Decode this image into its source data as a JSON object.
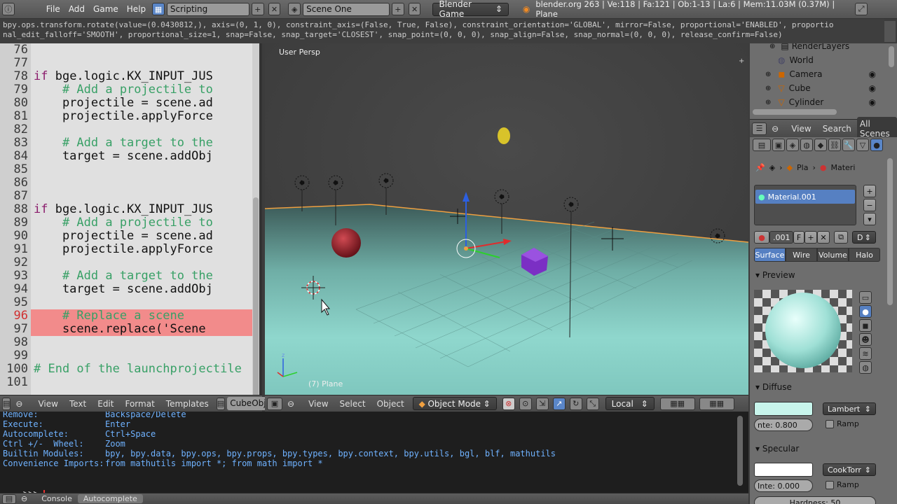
{
  "topbar": {
    "menus": [
      "File",
      "Add",
      "Game",
      "Help"
    ],
    "screen_layout": "Scripting",
    "scene": "Scene One",
    "engine": "Blender Game",
    "stats": "blender.org 263 | Ve:118 | Fa:121 | Ob:1-13 | La:6 | Mem:11.03M (0.37M) | Plane"
  },
  "infolog": {
    "line1": "bpy.ops.transform.rotate(value=(0.0430812,), axis=(0, 1, 0), constraint_axis=(False, True, False), constraint_orientation='GLOBAL', mirror=False, proportional='ENABLED', proportio",
    "line2": "nal_edit_falloff='SMOOTH', proportional_size=1, snap=False, snap_target='CLOSEST', snap_point=(0, 0, 0), snap_align=False, snap_normal=(0, 0, 0), release_confirm=False)"
  },
  "text_editor": {
    "lines": [
      {
        "n": "76",
        "code": ""
      },
      {
        "n": "77",
        "code": ""
      },
      {
        "n": "78",
        "kw": "if",
        "code": " bge.logic.KX_INPUT_JUS"
      },
      {
        "n": "79",
        "cm": "    # Add a projectile to"
      },
      {
        "n": "80",
        "code": "    projectile = scene.ad"
      },
      {
        "n": "81",
        "code": "    projectile.applyForce"
      },
      {
        "n": "82",
        "code": ""
      },
      {
        "n": "83",
        "cm": "    # Add a target to the"
      },
      {
        "n": "84",
        "code": "    target = scene.addObj"
      },
      {
        "n": "85",
        "code": ""
      },
      {
        "n": "86",
        "code": ""
      },
      {
        "n": "87",
        "code": ""
      },
      {
        "n": "88",
        "kw": "if",
        "code": " bge.logic.KX_INPUT_JUS"
      },
      {
        "n": "89",
        "cm": "    # Add a projectile to"
      },
      {
        "n": "90",
        "code": "    projectile = scene.ad"
      },
      {
        "n": "91",
        "code": "    projectile.applyForce"
      },
      {
        "n": "92",
        "code": ""
      },
      {
        "n": "93",
        "cm": "    # Add a target to the"
      },
      {
        "n": "94",
        "code": "    target = scene.addObj"
      },
      {
        "n": "95",
        "code": ""
      },
      {
        "n": "96",
        "cm": "    # Replace a scene"
      },
      {
        "n": "97",
        "code": "    scene.replace('Scene"
      },
      {
        "n": "98",
        "code": ""
      },
      {
        "n": "99",
        "code": ""
      },
      {
        "n": "100",
        "cm": "# End of the launchprojectile"
      },
      {
        "n": "101",
        "code": ""
      }
    ],
    "header": {
      "view": "View",
      "text": "Text",
      "edit": "Edit",
      "format": "Format",
      "templates": "Templates",
      "textblock": "CubeObjec"
    }
  },
  "viewport": {
    "label": "User Persp",
    "object_label": "(7) Plane",
    "header": {
      "view": "View",
      "select": "Select",
      "object": "Object",
      "mode": "Object Mode",
      "orientation": "Local"
    }
  },
  "console": {
    "rows": [
      {
        "k": "Remove:",
        "v": "Backspace/Delete"
      },
      {
        "k": "Execute:",
        "v": "Enter"
      },
      {
        "k": "Autocomplete:",
        "v": "Ctrl+Space"
      },
      {
        "k": "Ctrl +/-  Wheel:",
        "v": "Zoom"
      },
      {
        "k": "Builtin Modules:",
        "v": "bpy, bpy.data, bpy.ops, bpy.props, bpy.types, bpy.context, bpy.utils, bgl, blf, mathutils"
      },
      {
        "k": "Convenience Imports:",
        "v": "from mathutils import *; from math import *"
      }
    ],
    "prompt": ">>> ",
    "tabs": [
      "Console",
      "Autocomplete"
    ]
  },
  "outliner": {
    "items": [
      "RenderLayers",
      "World",
      "Camera",
      "Cube",
      "Cylinder"
    ],
    "header": {
      "view": "View",
      "search": "Search",
      "filter": "All Scenes"
    }
  },
  "properties": {
    "breadcrumb": [
      "Pla",
      "Materi"
    ],
    "material_slot": "Material.001",
    "material_name": ".001",
    "fake_user": "F",
    "data_dd": "D",
    "tabs": [
      "Surface",
      "Wire",
      "Volume",
      "Halo"
    ],
    "preview_title": "Preview",
    "diffuse_title": "Diffuse",
    "diffuse_shader": "Lambert",
    "diffuse_intensity": "nte: 0.800",
    "ramp": "Ramp",
    "specular_title": "Specular",
    "specular_shader": "CookTorr",
    "specular_intensity": "Inte: 0.000",
    "specular_ramp": "Ramp",
    "hardness": "Hardness: 50"
  },
  "colors": {
    "accent": "#5680c2",
    "highlight_line": "#f28b8b",
    "diffuse_color": "#c8f5ec",
    "floor": "#7fc7be"
  }
}
